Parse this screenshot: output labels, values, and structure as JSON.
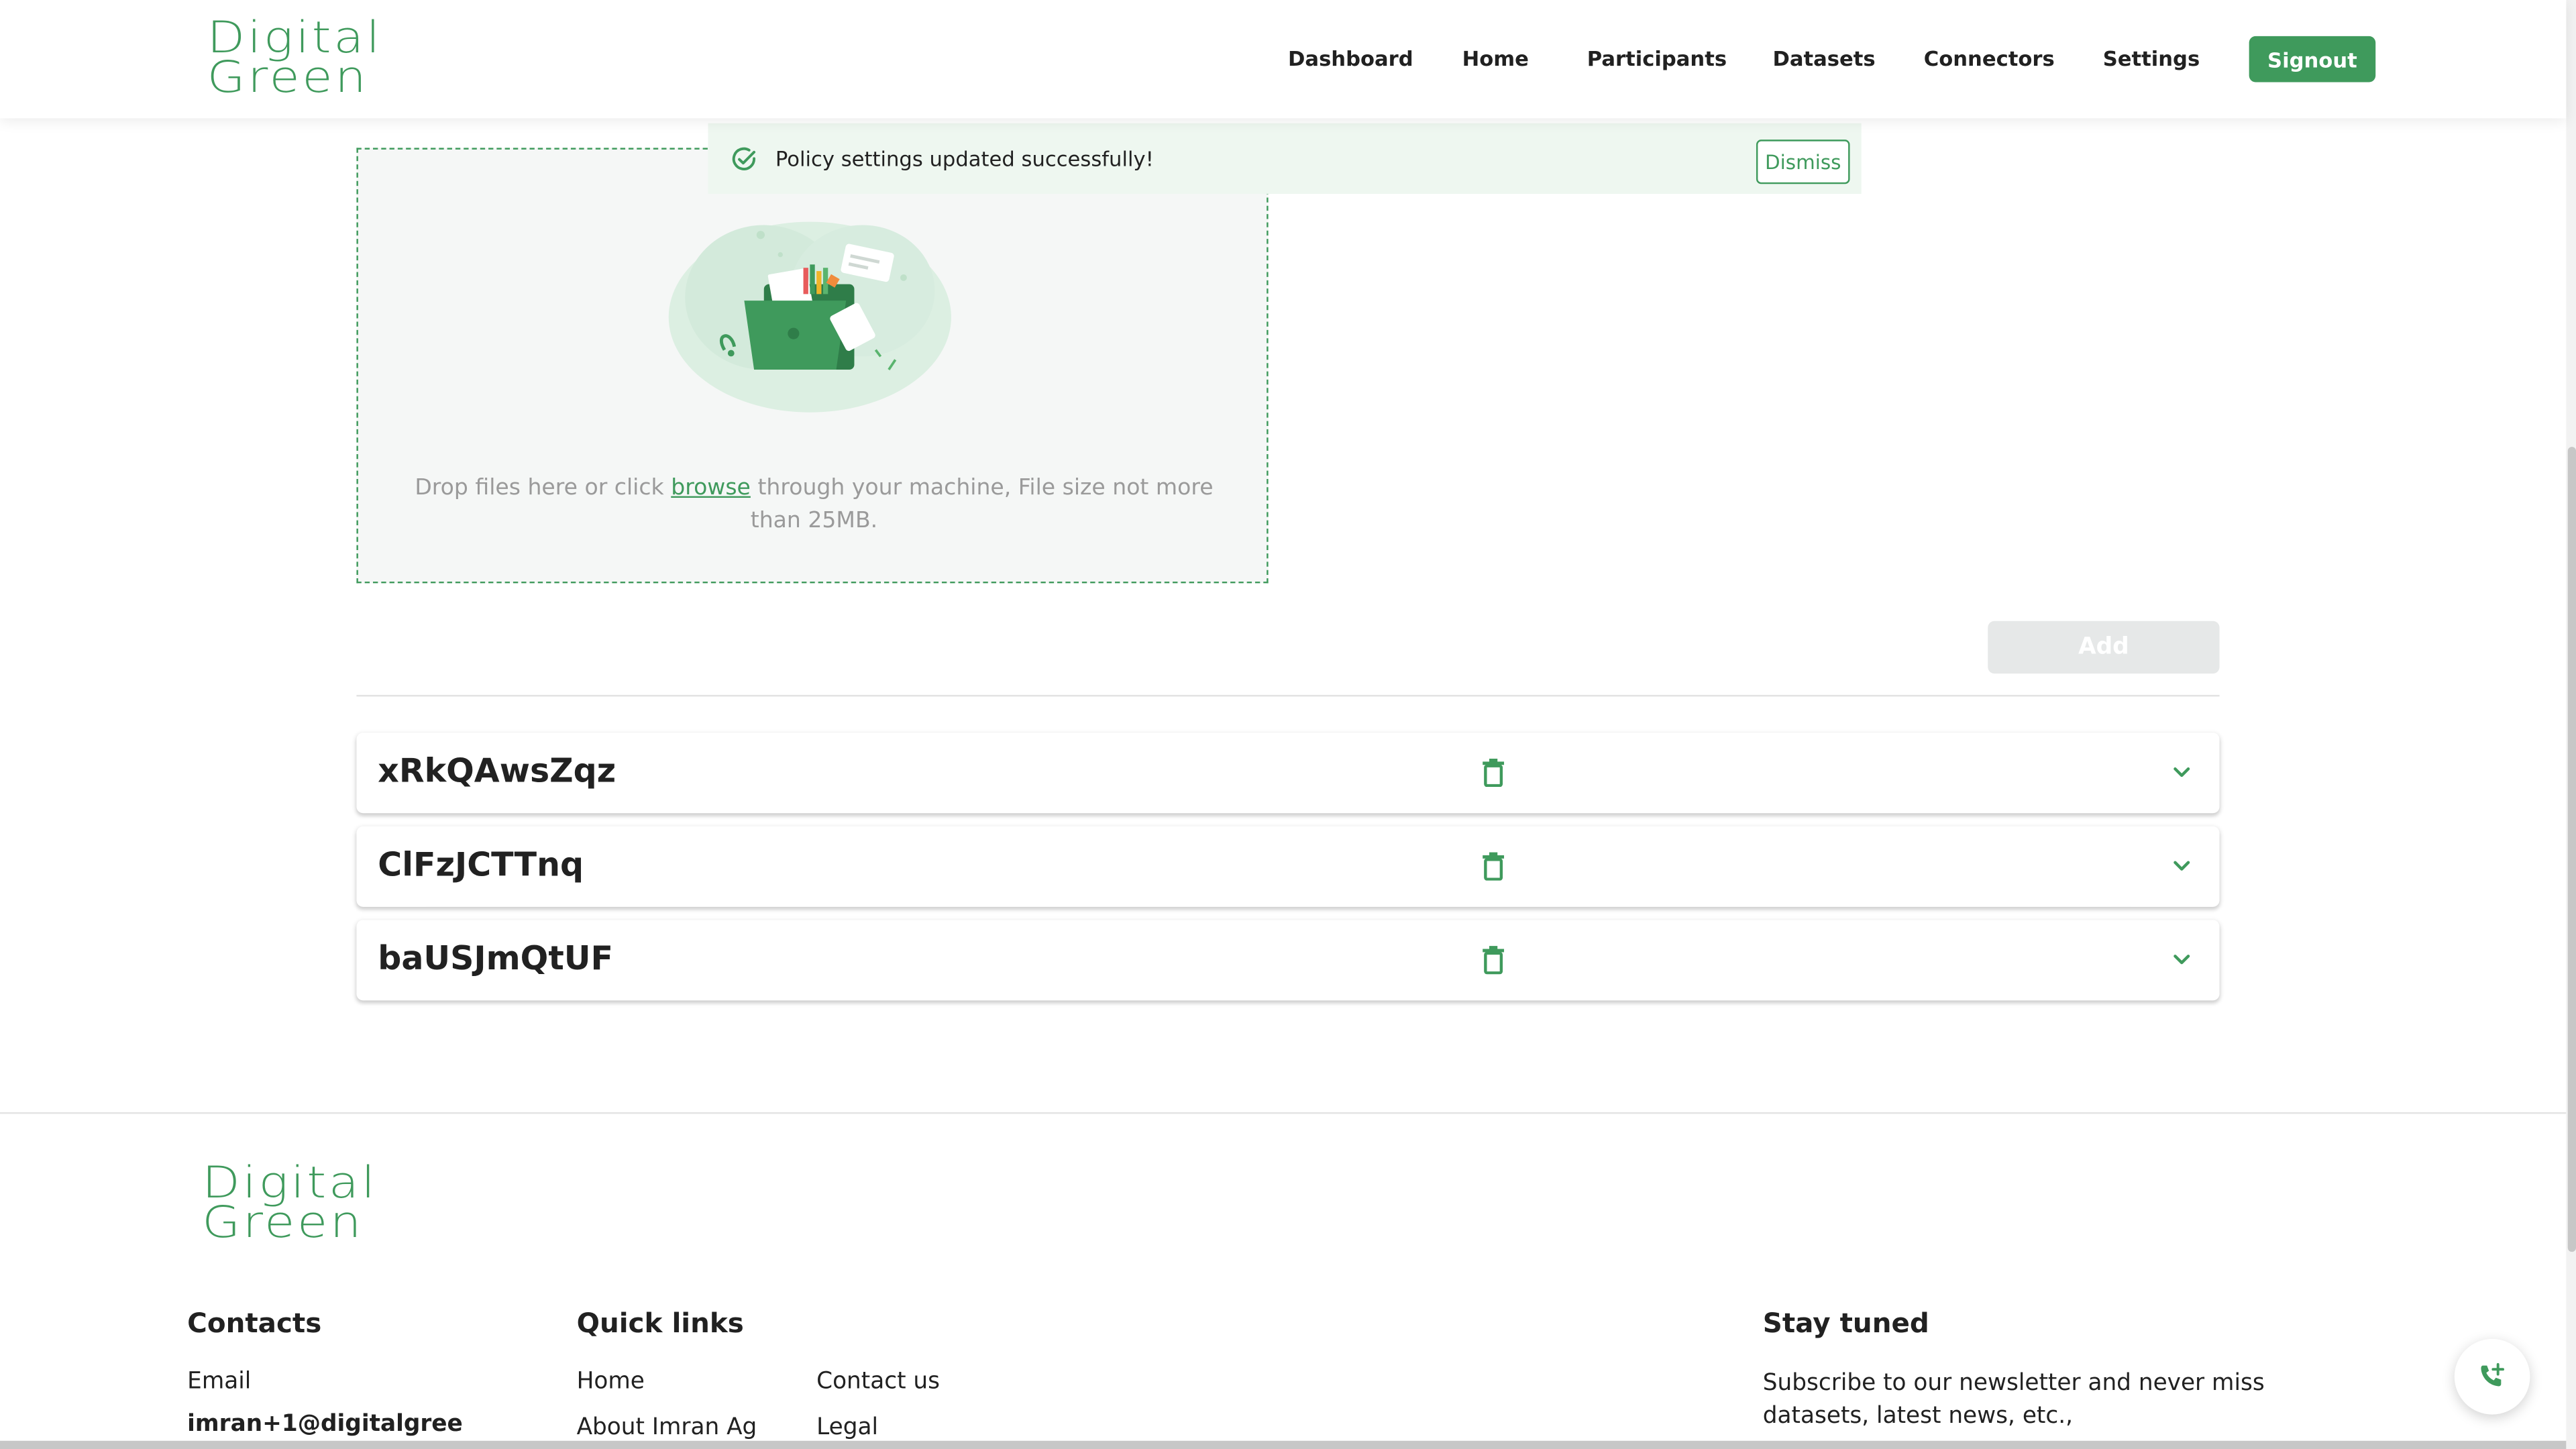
{
  "brand": {
    "line1": "Digital",
    "line2": "Green",
    "color": "#3f9a5c"
  },
  "nav": {
    "items": [
      "Dashboard",
      "Home",
      "Participants",
      "Datasets",
      "Connectors",
      "Settings"
    ],
    "signout": "Signout"
  },
  "toast": {
    "icon": "check-circle-icon",
    "message": "Policy settings updated successfully!",
    "dismiss": "Dismiss"
  },
  "upload": {
    "icon": "folder-illustration",
    "text_before": "Drop files here or click",
    "link": "browse",
    "text_after": "through your machine, File size not more than 25MB."
  },
  "add_button": "Add",
  "policies": [
    {
      "name": "xRkQAwsZqz"
    },
    {
      "name": "ClFzJCTTnq"
    },
    {
      "name": "baUSJmQtUF"
    }
  ],
  "footer": {
    "contacts": {
      "heading": "Contacts",
      "email_label": "Email",
      "email_value": "imran+1@digitalgree"
    },
    "quick_links": {
      "heading": "Quick links",
      "links": [
        "Home",
        "Contact us",
        "About Imran Ag",
        "Legal"
      ]
    },
    "stay_tuned": {
      "heading": "Stay tuned",
      "text": "Subscribe to our newsletter and never miss datasets, latest news, etc.,"
    },
    "fab_icon": "phone-add-icon"
  }
}
